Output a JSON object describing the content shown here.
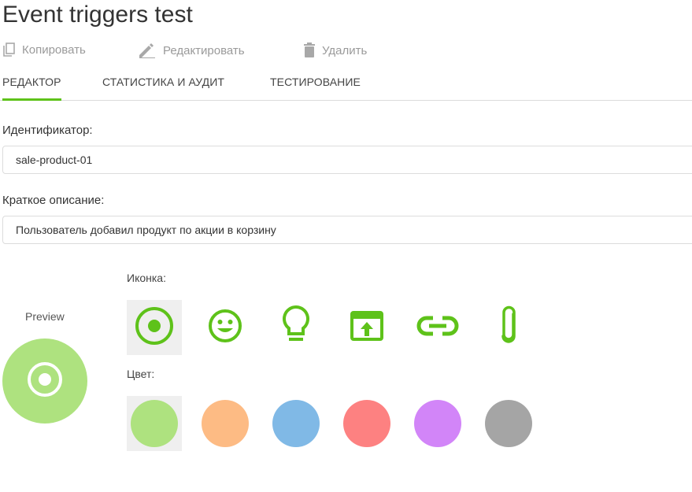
{
  "page": {
    "title": "Event triggers test"
  },
  "toolbar": {
    "copy_label": "Копировать",
    "edit_label": "Редактировать",
    "delete_label": "Удалить"
  },
  "tabs": [
    {
      "label": "РЕДАКТОР",
      "active": true
    },
    {
      "label": "СТАТИСТИКА И АУДИТ",
      "active": false
    },
    {
      "label": "ТЕСТИРОВАНИЕ",
      "active": false
    }
  ],
  "form": {
    "id_label": "Идентификатор:",
    "id_value": "sale-product-01",
    "desc_label": "Краткое описание:",
    "desc_value": "Пользователь добавил продукт по акции в корзину"
  },
  "preview": {
    "label": "Preview",
    "icon": "radio-button-icon",
    "color": "#aee27f"
  },
  "icons": {
    "label": "Иконка:",
    "accent": "#5ec21a",
    "items": [
      "radio-button-icon",
      "smiley-icon",
      "lightbulb-icon",
      "open-in-app-icon",
      "link-icon",
      "paperclip-icon"
    ],
    "selected": 0
  },
  "colors": {
    "label": "Цвет:",
    "items": [
      "#aee27f",
      "#fdbb84",
      "#80b9e6",
      "#fd8181",
      "#d285f8",
      "#a5a5a5"
    ],
    "selected": 0
  }
}
